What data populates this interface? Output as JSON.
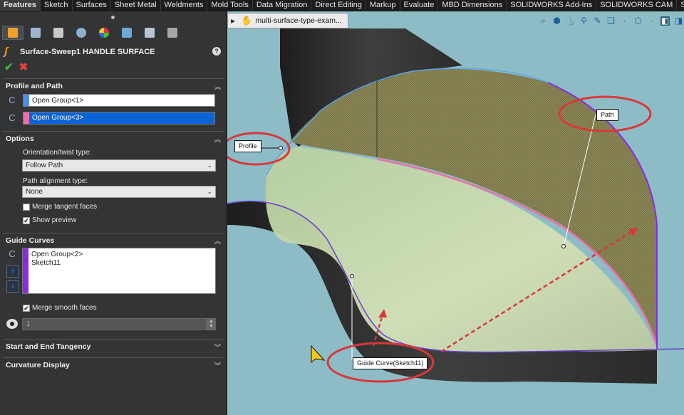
{
  "tabs": [
    "Features",
    "Sketch",
    "Surfaces",
    "Sheet Metal",
    "Weldments",
    "Mold Tools",
    "Data Migration",
    "Direct Editing",
    "Markup",
    "Evaluate",
    "MBD Dimensions",
    "SOLIDWORKS Add-Ins",
    "SOLIDWORKS CAM",
    "SOLIDWORKS CAM"
  ],
  "active_tab": "Features",
  "panel": {
    "feature_title": "Surface-Sweep1 HANDLE SURFACE",
    "help": "?",
    "ok_glyph": "✔",
    "cancel_glyph": "✖",
    "profile_path": {
      "title": "Profile and Path",
      "profile_value": "Open Group<1>",
      "profile_color": "#4a90e2",
      "path_value": "Open Group<3>",
      "path_color": "#ef6ea8"
    },
    "options": {
      "title": "Options",
      "orientation_label": "Orientation/twist type:",
      "orientation_value": "Follow Path",
      "alignment_label": "Path alignment type:",
      "alignment_value": "None",
      "merge_tangent_label": "Merge tangent faces",
      "merge_tangent_checked": false,
      "show_preview_label": "Show preview",
      "show_preview_checked": true
    },
    "guide_curves": {
      "title": "Guide Curves",
      "items": [
        "Open Group<2>",
        "Sketch11"
      ],
      "item_color": "#8a2be2",
      "merge_smooth_label": "Merge smooth faces",
      "merge_smooth_checked": true,
      "spin_value": "1"
    },
    "start_end": {
      "title": "Start and End Tangency"
    },
    "curvature": {
      "title": "Curvature Display"
    }
  },
  "viewport": {
    "breadcrumb": "multi-surface-type-exam...",
    "callouts": {
      "profile": "Profile",
      "path": "Path",
      "guide": "Guide Curve(Sketch11)"
    },
    "colors": {
      "background": "#8dbcc7",
      "highlight_ellipse": "#d9383a",
      "surface_preview": "#c9d9a4",
      "path_edge": "#ef6ea8",
      "guide_edge": "#8a2be2"
    }
  }
}
